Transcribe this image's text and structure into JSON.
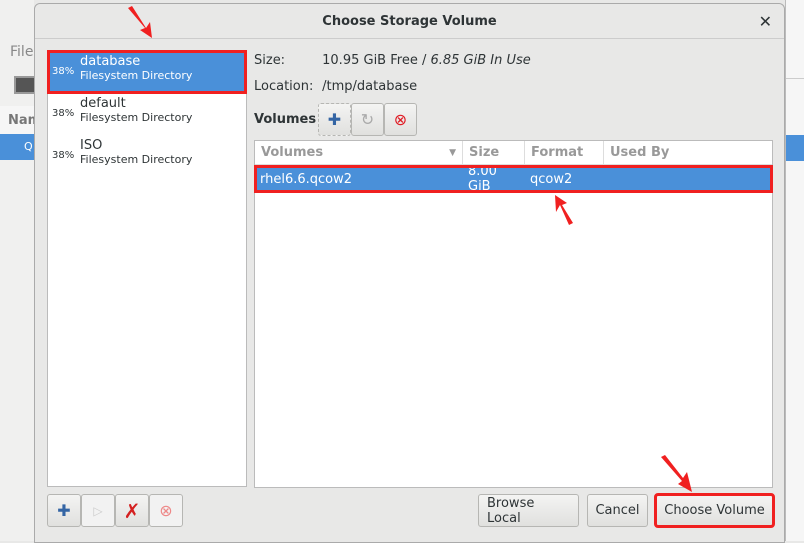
{
  "background": {
    "menu": "File",
    "column": "Nam",
    "row": "Q"
  },
  "dialog": {
    "title": "Choose Storage Volume"
  },
  "pools": [
    {
      "pct": "38%",
      "name": "database",
      "type": "Filesystem Directory",
      "selected": true
    },
    {
      "pct": "38%",
      "name": "default",
      "type": "Filesystem Directory"
    },
    {
      "pct": "38%",
      "name": "ISO",
      "type": "Filesystem Directory"
    }
  ],
  "info": {
    "size_label": "Size:",
    "size_free": "10.95 GiB Free",
    "size_sep": " / ",
    "size_used": "6.85 GiB In Use",
    "location_label": "Location:",
    "location": "/tmp/database",
    "volumes_label": "Volumes"
  },
  "table": {
    "headers": [
      "Volumes",
      "Size",
      "Format",
      "Used By"
    ],
    "rows": [
      {
        "name": "rhel6.6.qcow2",
        "size": "8.00 GiB",
        "format": "qcow2",
        "used_by": ""
      }
    ]
  },
  "buttons": {
    "browse": "Browse Local",
    "cancel": "Cancel",
    "choose": "Choose Volume"
  },
  "colors": {
    "selection": "#4a90d9",
    "highlight": "#f02020"
  }
}
